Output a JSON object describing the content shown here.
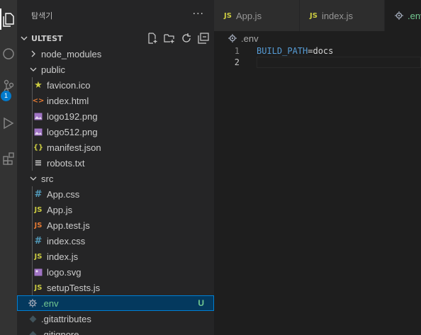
{
  "sidebar": {
    "title": "탐색기",
    "more": "···",
    "section": "ULTEST"
  },
  "tree": {
    "node_modules": "node_modules",
    "public": "public",
    "public_files": [
      "favicon.ico",
      "index.html",
      "logo192.png",
      "logo512.png",
      "manifest.json",
      "robots.txt"
    ],
    "src": "src",
    "src_files": [
      "App.css",
      "App.js",
      "App.test.js",
      "index.css",
      "index.js",
      "logo.svg",
      "setupTests.js"
    ],
    "root_files": [
      ".env",
      ".gitattributes",
      ".gitignore"
    ],
    "env_status": "U"
  },
  "activity": {
    "scm_badge": "1"
  },
  "tabs": [
    {
      "label": "App.js",
      "icon": "JS"
    },
    {
      "label": "index.js",
      "icon": "JS"
    },
    {
      "label": ".env"
    }
  ],
  "breadcrumb": ".env",
  "editor": {
    "lines": [
      {
        "num": "1",
        "key": "BUILD_PATH",
        "eq": "=",
        "value": "docs"
      },
      {
        "num": "2"
      }
    ]
  },
  "colors": {
    "accent": "#007acc",
    "selection": "#04395e",
    "untracked": "#73c991",
    "js": "#cbcb41"
  }
}
